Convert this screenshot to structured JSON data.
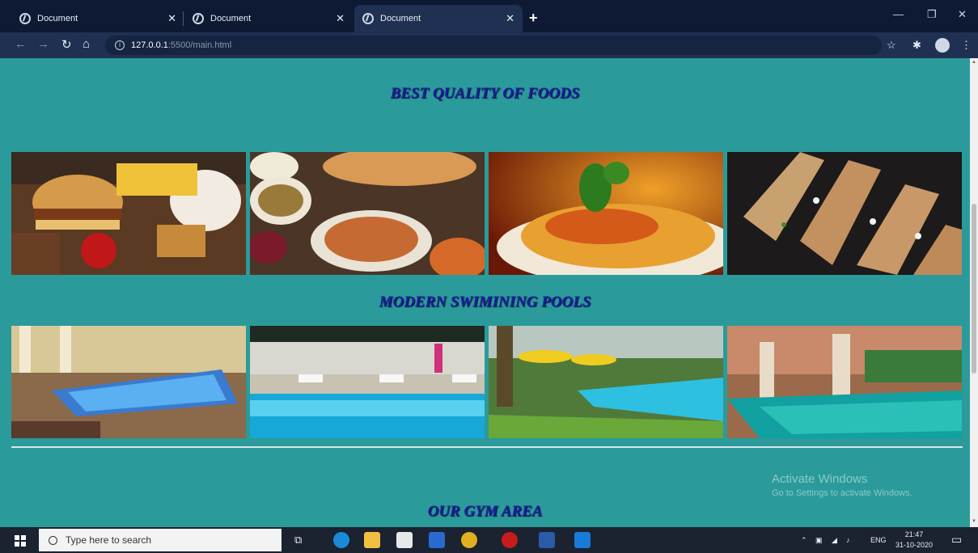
{
  "browser": {
    "tabs": [
      {
        "label": "Document",
        "active": false
      },
      {
        "label": "Document",
        "active": false
      },
      {
        "label": "Document",
        "active": true
      }
    ],
    "address_host": "127.0.0.1",
    "address_path": ":5500/main.html"
  },
  "page": {
    "food_heading": "BEST QUALITY OF FOODS",
    "pool_heading": "MODERN SWIMINING POOLS",
    "gym_heading": "OUR GYM AREA",
    "food_images": [
      "burger-fast-food-image",
      "roast-dinner-spread-image",
      "penne-pasta-image",
      "grilled-tacos-image"
    ],
    "pool_images": [
      "indoor-pool-image",
      "poolside-loungers-image",
      "resort-pool-umbrellas-image",
      "hotel-pool-image"
    ]
  },
  "watermark": {
    "line1": "Activate Windows",
    "line2": "Go to Settings to activate Windows."
  },
  "taskbar": {
    "search_placeholder": "Type here to search",
    "language": "ENG",
    "time": "21:47",
    "date": "31-10-2020"
  },
  "colors": {
    "page_background": "#2b9a9a",
    "heading_color": "#1a1f9a",
    "tab_strip": "#0e1a33",
    "taskbar": "#1b2230"
  }
}
